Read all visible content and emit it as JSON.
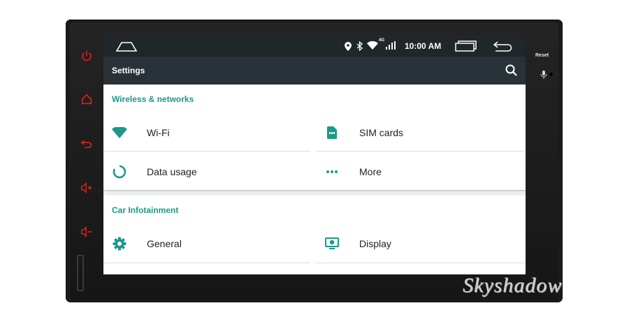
{
  "status_bar": {
    "time": "10:00 AM",
    "network_badge": "4G",
    "icons": [
      "home-outline-icon",
      "location-icon",
      "bluetooth-icon",
      "wifi-icon",
      "signal-icon",
      "recent-apps-icon",
      "back-icon"
    ]
  },
  "app_bar": {
    "title": "Settings",
    "search_icon": "search-icon"
  },
  "sections": [
    {
      "title": "Wireless & networks",
      "items": [
        {
          "label": "Wi-Fi",
          "icon": "wifi-icon"
        },
        {
          "label": "SIM cards",
          "icon": "sim-card-icon"
        },
        {
          "label": "Data usage",
          "icon": "data-usage-icon"
        },
        {
          "label": "More",
          "icon": "more-dots-icon"
        }
      ]
    },
    {
      "title": "Car Infotainment",
      "items": [
        {
          "label": "General",
          "icon": "gear-icon"
        },
        {
          "label": "Display",
          "icon": "display-icon"
        }
      ]
    }
  ],
  "device": {
    "side_buttons": [
      "power-icon",
      "home-icon",
      "back-icon",
      "volume-up-icon",
      "volume-down-icon"
    ],
    "reset_label": "Reset"
  },
  "watermark": {
    "text": "Skyshadow"
  },
  "colors": {
    "accent": "#1b998b",
    "hardware_icons": "#e0211b",
    "status_bar": "#20272b",
    "app_bar": "#283238",
    "bezel": "#1b1b1b"
  }
}
